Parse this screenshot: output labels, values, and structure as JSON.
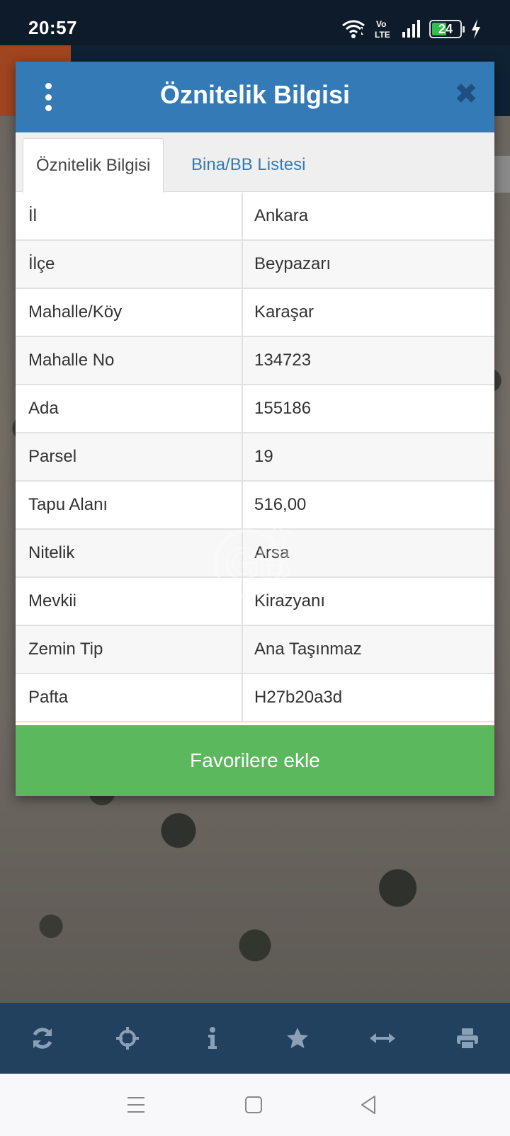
{
  "status_bar": {
    "time": "20:57",
    "network_label": "Vo LTE",
    "battery_level": "24",
    "icons": [
      "wifi-icon",
      "volte-icon",
      "signal-icon",
      "battery-icon",
      "charging-icon"
    ]
  },
  "dialog": {
    "title": "Öznitelik Bilgisi",
    "menu_icon": "more-vert-icon",
    "close_icon": "close-icon",
    "tabs": [
      {
        "label": "Öznitelik Bilgisi",
        "active": true
      },
      {
        "label": "Bina/BB Listesi",
        "active": false
      }
    ],
    "rows": [
      {
        "key": "İl",
        "value": "Ankara"
      },
      {
        "key": "İlçe",
        "value": "Beypazarı"
      },
      {
        "key": "Mahalle/Köy",
        "value": "Karaşar"
      },
      {
        "key": "Mahalle No",
        "value": "134723"
      },
      {
        "key": "Ada",
        "value": "155186"
      },
      {
        "key": "Parsel",
        "value": "19"
      },
      {
        "key": "Tapu Alanı",
        "value": "516,00"
      },
      {
        "key": "Nitelik",
        "value": "Arsa"
      },
      {
        "key": "Mevkii",
        "value": "Kirazyanı"
      },
      {
        "key": "Zemin Tip",
        "value": "Ana Taşınmaz"
      },
      {
        "key": "Pafta",
        "value": "H27b20a3d"
      }
    ],
    "favorite_button": "Favorilere ekle"
  },
  "watermark": {
    "text": "GB"
  },
  "toolbar": {
    "items": [
      "refresh-icon",
      "crosshair-icon",
      "info-icon",
      "star-icon",
      "measure-icon",
      "print-icon"
    ]
  },
  "navbar": {
    "items": [
      "menu-nav-icon",
      "home-nav-icon",
      "back-nav-icon"
    ]
  },
  "colors": {
    "header_blue": "#337ab7",
    "button_green": "#5cb85c",
    "toolbar_blue": "#22415f",
    "status_bar": "#0d1b2a"
  }
}
